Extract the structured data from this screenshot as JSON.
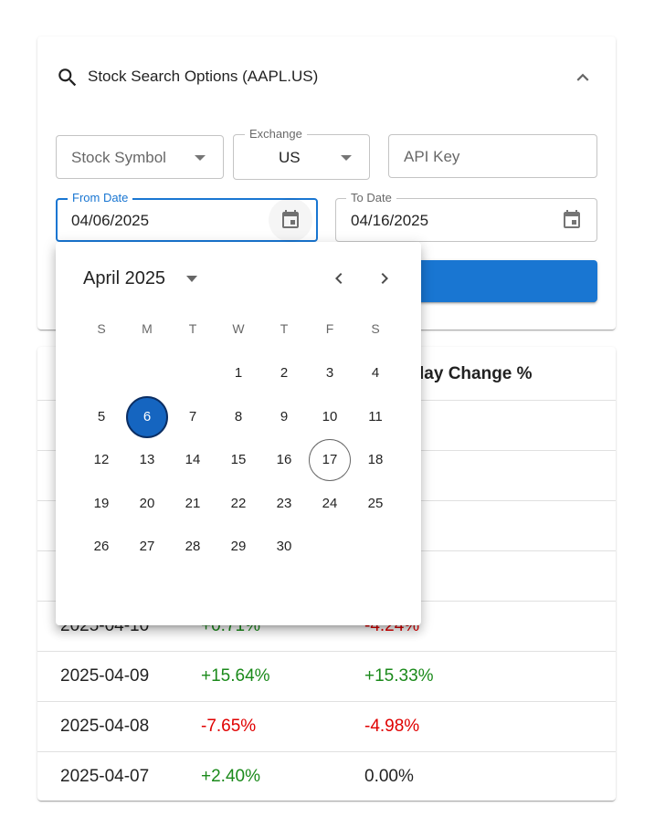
{
  "accordion": {
    "title": "Stock Search Options (AAPL.US)",
    "search_icon": "search-icon",
    "collapse_icon": "chevron-up-icon"
  },
  "form": {
    "symbol": {
      "placeholder": "Stock Symbol"
    },
    "exchange": {
      "label": "Exchange",
      "value": "US"
    },
    "api_key": {
      "placeholder": "API Key"
    },
    "from_date": {
      "label": "From Date",
      "value": "04/06/2025"
    },
    "to_date": {
      "label": "To Date",
      "value": "04/16/2025"
    },
    "calendar_icon": "calendar-icon"
  },
  "table": {
    "visible_header": "lay Change %",
    "rows": [
      {
        "date": "",
        "a": "",
        "a_sign": "neg",
        "b": "",
        "b_sign": "neg"
      },
      {
        "date": "",
        "a": "",
        "a_sign": "neg",
        "b": "",
        "b_sign": "neg"
      },
      {
        "date": "",
        "a": "",
        "a_sign": "pos",
        "b": "%",
        "b_sign": "pos"
      },
      {
        "date": "",
        "a": "",
        "a_sign": "pos",
        "b": "%",
        "b_sign": "pos"
      },
      {
        "date": "2025-04-10",
        "a": "+0.71%",
        "a_sign": "pos",
        "b": "-4.24%",
        "b_sign": "neg"
      },
      {
        "date": "2025-04-09",
        "a": "+15.64%",
        "a_sign": "pos",
        "b": "+15.33%",
        "b_sign": "pos"
      },
      {
        "date": "2025-04-08",
        "a": "-7.65%",
        "a_sign": "neg",
        "b": "-4.98%",
        "b_sign": "neg"
      },
      {
        "date": "2025-04-07",
        "a": "+2.40%",
        "a_sign": "pos",
        "b": "0.00%",
        "b_sign": "neu"
      }
    ]
  },
  "date_picker": {
    "month_label": "April 2025",
    "weekdays": [
      "S",
      "M",
      "T",
      "W",
      "T",
      "F",
      "S"
    ],
    "first_weekday_index": 2,
    "days_in_month": 30,
    "selected_day": 6,
    "today_day": 17,
    "prev_icon": "chevron-left-icon",
    "next_icon": "chevron-right-icon",
    "view_switch_icon": "arrow-drop-down-icon"
  },
  "colors": {
    "primary": "#1976d2",
    "selected_day": "#1565c0",
    "positive": "#1b8a1b",
    "negative": "#e00000"
  }
}
